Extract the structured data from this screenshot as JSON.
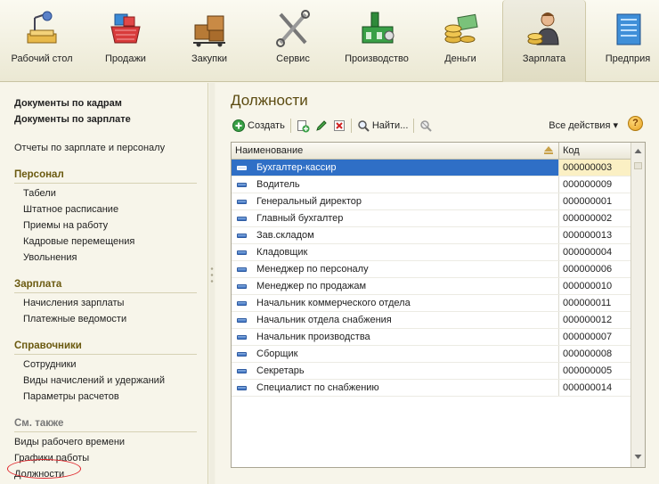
{
  "sections": [
    {
      "label": "Рабочий стол",
      "icon": "desk-lamp-icon"
    },
    {
      "label": "Продажи",
      "icon": "shopping-basket-icon"
    },
    {
      "label": "Закупки",
      "icon": "boxes-cart-icon"
    },
    {
      "label": "Сервис",
      "icon": "tools-icon"
    },
    {
      "label": "Производство",
      "icon": "factory-icon"
    },
    {
      "label": "Деньги",
      "icon": "coins-icon"
    },
    {
      "label": "Зарплата",
      "icon": "worker-coins-icon",
      "active": true
    },
    {
      "label": "Предприя",
      "icon": "building-icon"
    }
  ],
  "left": {
    "top_links": [
      "Документы по кадрам",
      "Документы по зарплате"
    ],
    "reports_link": "Отчеты по зарплате и персоналу",
    "personnel": {
      "title": "Персонал",
      "items": [
        "Табели",
        "Штатное расписание",
        "Приемы на работу",
        "Кадровые перемещения",
        "Увольнения"
      ]
    },
    "salary": {
      "title": "Зарплата",
      "items": [
        "Начисления зарплаты",
        "Платежные ведомости"
      ]
    },
    "refs": {
      "title": "Справочники",
      "items": [
        "Сотрудники",
        "Виды начислений и удержаний",
        "Параметры расчетов"
      ]
    },
    "see_also": {
      "title": "См. также",
      "items": [
        "Виды рабочего времени",
        "Графики работы",
        "Должности"
      ]
    }
  },
  "main": {
    "title": "Должности",
    "toolbar": {
      "create_label": "Создать",
      "find_label": "Найти...",
      "all_actions_label": "Все действия ▾",
      "help_label": "?"
    },
    "columns": {
      "name": "Наименование",
      "code": "Код"
    },
    "rows": [
      {
        "name": "Бухгалтер-кассир",
        "code": "000000003"
      },
      {
        "name": "Водитель",
        "code": "000000009"
      },
      {
        "name": "Генеральный директор",
        "code": "000000001"
      },
      {
        "name": "Главный бухгалтер",
        "code": "000000002"
      },
      {
        "name": "Зав.складом",
        "code": "000000013"
      },
      {
        "name": "Кладовщик",
        "code": "000000004"
      },
      {
        "name": "Менеджер по персоналу",
        "code": "000000006"
      },
      {
        "name": "Менеджер по продажам",
        "code": "000000010"
      },
      {
        "name": "Начальник коммерческого отдела",
        "code": "000000011"
      },
      {
        "name": "Начальник отдела снабжения",
        "code": "000000012"
      },
      {
        "name": "Начальник производства",
        "code": "000000007"
      },
      {
        "name": "Сборщик",
        "code": "000000008"
      },
      {
        "name": "Секретарь",
        "code": "000000005"
      },
      {
        "name": "Специалист по снабжению",
        "code": "000000014"
      }
    ]
  },
  "colors": {
    "accent_title": "#5b4a10",
    "selection": "#2f6fc6",
    "highlight_circle": "#e0242a"
  }
}
